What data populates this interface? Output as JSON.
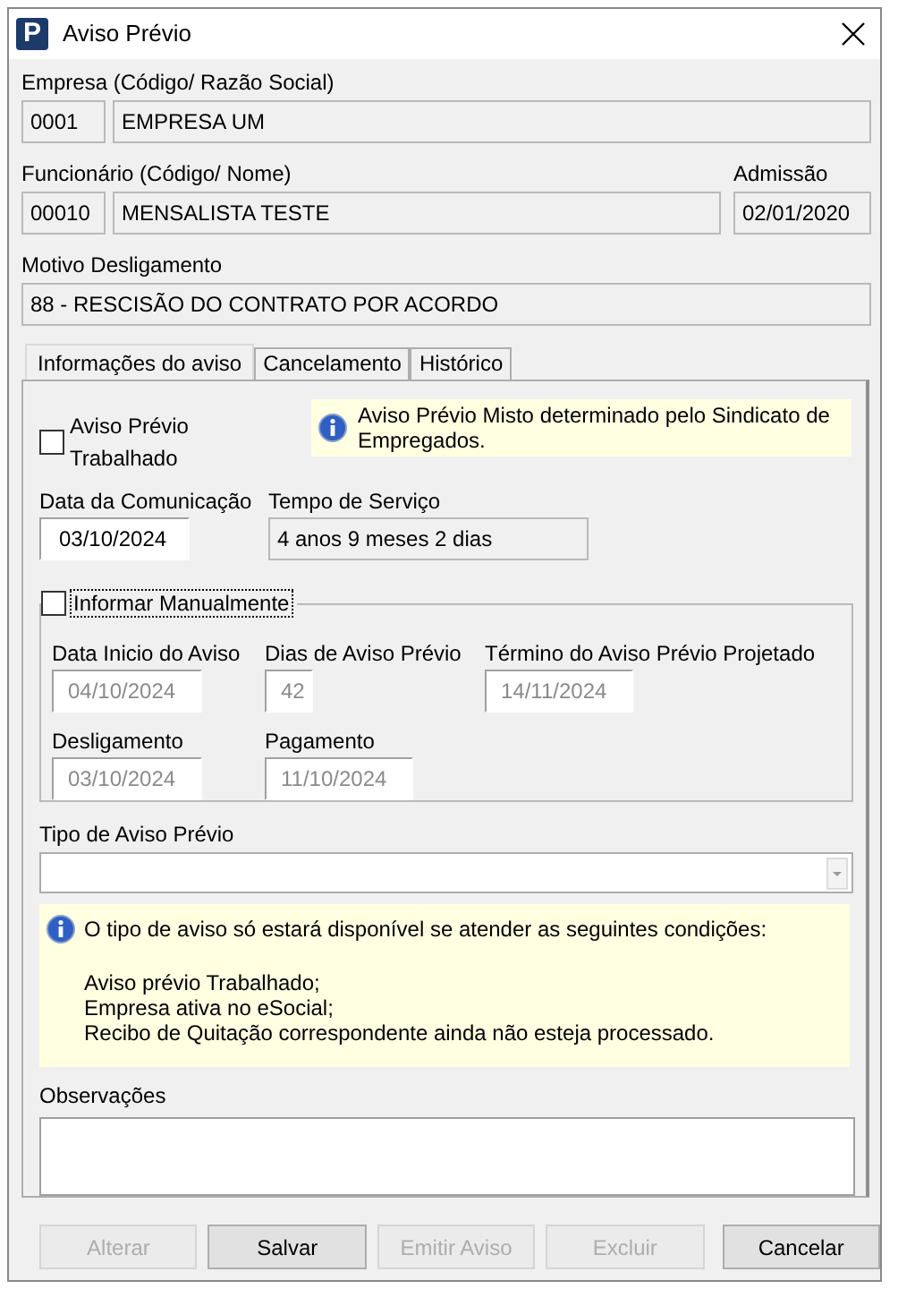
{
  "window": {
    "app_logo": "P",
    "title": "Aviso Prévio"
  },
  "empresa": {
    "label": "Empresa (Código/ Razão Social)",
    "code": "0001",
    "name": "EMPRESA UM"
  },
  "funcionario": {
    "label": "Funcionário (Código/ Nome)",
    "code": "00010",
    "name": "MENSALISTA TESTE"
  },
  "admissao": {
    "label": "Admissão",
    "value": "02/01/2020"
  },
  "motivo": {
    "label": "Motivo Desligamento",
    "value": "88 - RESCISÃO DO CONTRATO POR ACORDO"
  },
  "tabs": [
    {
      "label": "Informações do aviso",
      "selected": true
    },
    {
      "label": "Cancelamento",
      "selected": false
    },
    {
      "label": "Histórico",
      "selected": false
    }
  ],
  "aviso_trabalhado": {
    "label": "Aviso Prévio Trabalhado",
    "checked": false
  },
  "info_note": "Aviso Prévio Misto determinado pelo Sindicato de Empregados.",
  "data_comunicacao": {
    "label": "Data da Comunicação",
    "value": "03/10/2024"
  },
  "tempo_servico": {
    "label": "Tempo de Serviço",
    "value": "4 anos 9 meses 2 dias"
  },
  "manual": {
    "label": "Informar Manualmente",
    "checked": false,
    "rows": [
      [
        {
          "label": "Data Inicio do Aviso",
          "value": "04/10/2024",
          "disabled": true
        },
        {
          "label": "Dias de Aviso Prévio",
          "value": "42",
          "disabled": true
        },
        {
          "label": "Término do Aviso Prévio Projetado",
          "value": "14/11/2024",
          "disabled": true
        }
      ],
      [
        {
          "label": "Desligamento",
          "value": "03/10/2024",
          "disabled": true
        },
        {
          "label": "Pagamento",
          "value": "11/10/2024",
          "disabled": true
        }
      ]
    ]
  },
  "tipo_aviso": {
    "label": "Tipo de Aviso Prévio"
  },
  "conditions": {
    "title": "O tipo de aviso só estará disponível se atender as seguintes condições:",
    "lines": [
      "Aviso prévio Trabalhado;",
      "Empresa ativa no eSocial;",
      "Recibo de Quitação correspondente ainda não esteja processado."
    ]
  },
  "observacoes": {
    "label": "Observações"
  },
  "buttons": [
    {
      "label": "Alterar",
      "disabled": true
    },
    {
      "label": "Salvar",
      "disabled": false
    },
    {
      "label": "Emitir Aviso",
      "disabled": true
    },
    {
      "label": "Excluir",
      "disabled": true
    },
    {
      "label": "Cancelar",
      "disabled": false
    }
  ]
}
